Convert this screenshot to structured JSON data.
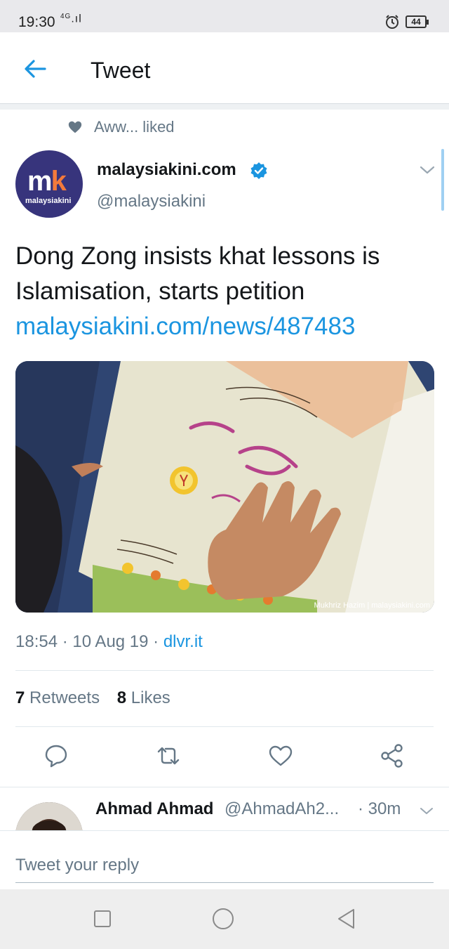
{
  "status_bar": {
    "time": "19:30",
    "network": "4G",
    "battery": "44"
  },
  "app_bar": {
    "title": "Tweet"
  },
  "social_context": {
    "text": "Aww... liked"
  },
  "tweet": {
    "author_name": "malaysiakini.com",
    "author_handle": "@malaysiakini",
    "avatar_text_main": "m",
    "avatar_text_accent": "k",
    "avatar_subtext": "malaysiakini",
    "text": "Dong Zong insists khat lessons is Islamisation, starts petition",
    "link": "malaysiakini.com/news/487483",
    "media_credit": "Mukhriz Hazim | malaysiakini.com",
    "time": "18:54",
    "date": "10 Aug 19",
    "source": "dlvr.it",
    "retweets_count": "7",
    "retweets_label": "Retweets",
    "likes_count": "8",
    "likes_label": "Likes"
  },
  "reply": {
    "name": "Ahmad Ahmad",
    "handle": "@AhmadAh2...",
    "time": "· 30m"
  },
  "reply_bar": {
    "placeholder": "Tweet your reply"
  },
  "icons": {
    "back": "arrow-left-icon",
    "verified": "verified-badge-icon",
    "reply": "comment-icon",
    "retweet": "retweet-icon",
    "like": "heart-icon",
    "share": "share-icon"
  },
  "colors": {
    "accent": "#1b95e0",
    "text": "#14171a",
    "muted": "#657786"
  }
}
